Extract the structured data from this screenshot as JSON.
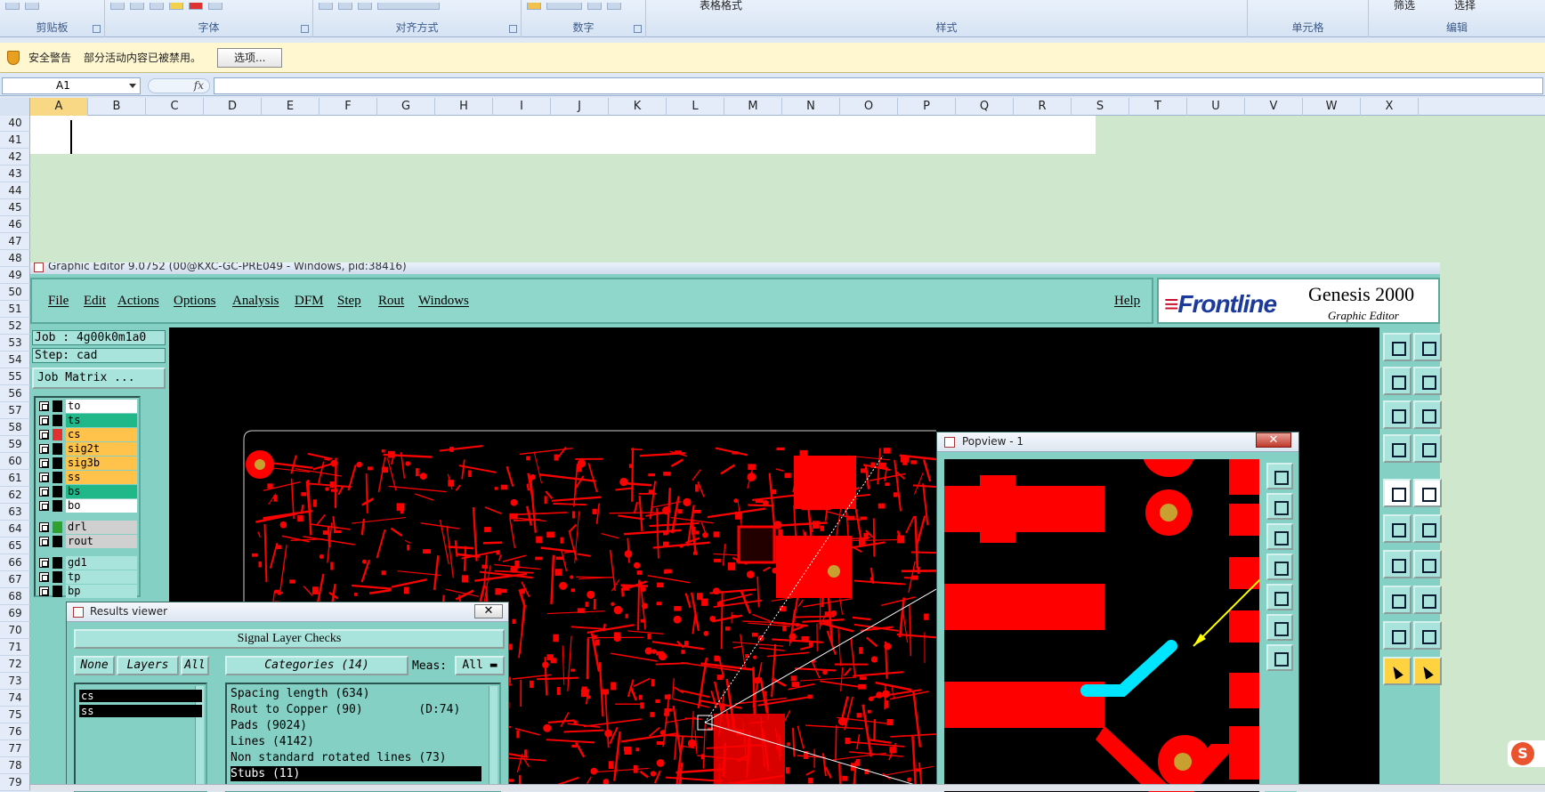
{
  "ribbon": {
    "groups": [
      {
        "label": "剪贴板"
      },
      {
        "label": "字体"
      },
      {
        "label": "对齐方式"
      },
      {
        "label": "数字"
      },
      {
        "label": "样式"
      },
      {
        "label": "单元格"
      },
      {
        "label": "编辑"
      }
    ],
    "styles_fragment": "表格格式",
    "filter_fragment": "筛选",
    "select_fragment": "选择"
  },
  "security": {
    "title": "安全警告",
    "message": "部分活动内容已被禁用。",
    "options_button": "选项..."
  },
  "formula_bar": {
    "name_box": "A1",
    "fx": "fx",
    "value": ""
  },
  "sheet": {
    "columns": [
      "A",
      "B",
      "C",
      "D",
      "E",
      "F",
      "G",
      "H",
      "I",
      "J",
      "K",
      "L",
      "M",
      "N",
      "O",
      "P",
      "Q",
      "R",
      "S",
      "T",
      "U",
      "V",
      "W",
      "X"
    ],
    "selected_column": "A",
    "rows": [
      "40",
      "41",
      "42",
      "43",
      "44",
      "45",
      "46",
      "47",
      "48",
      "49",
      "50",
      "51",
      "52",
      "53",
      "54",
      "55",
      "56",
      "57",
      "58",
      "59",
      "60",
      "61",
      "62",
      "63",
      "64",
      "65",
      "66",
      "67",
      "68",
      "69",
      "70",
      "71",
      "72",
      "73",
      "74",
      "75",
      "76",
      "77",
      "78",
      "79"
    ],
    "grid_color": "#cfe8cd"
  },
  "genesis": {
    "window_title": "Graphic Editor 9.0752 (00@KXC-GC-PRE049 - Windows, pid:38416)",
    "menu": [
      "File",
      "Edit",
      "Actions",
      "Options",
      "Analysis",
      "DFM",
      "Step",
      "Rout",
      "Windows"
    ],
    "help": "Help",
    "logo": {
      "brand": "Frontline",
      "product": "Genesis 2000",
      "subtitle": "Graphic Editor"
    },
    "job": "Job : 4g00k0m1a0",
    "step": "Step: cad",
    "job_matrix": "Job Matrix ...",
    "layers": [
      {
        "name": "to",
        "color": "#ffffff",
        "swatch": "#000000"
      },
      {
        "name": "ts",
        "color": "#20b888",
        "swatch": "#000000"
      },
      {
        "name": "cs",
        "color": "#ffc24a",
        "swatch": "#e03030"
      },
      {
        "name": "sig2t",
        "color": "#ffc24a",
        "swatch": "#000000"
      },
      {
        "name": "sig3b",
        "color": "#ffc24a",
        "swatch": "#000000"
      },
      {
        "name": "ss",
        "color": "#ffc24a",
        "swatch": "#000000"
      },
      {
        "name": "bs",
        "color": "#20b888",
        "swatch": "#000000"
      },
      {
        "name": "bo",
        "color": "#ffffff",
        "swatch": "#000000"
      },
      {
        "name": "drl",
        "color": "#d0d0d0",
        "swatch": "#30a030"
      },
      {
        "name": "rout",
        "color": "#d0d0d0",
        "swatch": "#000000"
      },
      {
        "name": "gd1",
        "color": "#a9e4dc",
        "swatch": "#000000"
      },
      {
        "name": "tp",
        "color": "#a9e4dc",
        "swatch": "#000000"
      },
      {
        "name": "bp",
        "color": "#a9e4dc",
        "swatch": "#000000"
      }
    ],
    "accent": "#84d0c4",
    "copper_color": "#ff0000",
    "highlight_color": "#00e5ff"
  },
  "results_viewer": {
    "title": "Results viewer",
    "header": "Signal Layer Checks",
    "none": "None",
    "layers_btn": "Layers",
    "all": "All",
    "categories_btn": "Categories (14)",
    "meas_label": "Meas:",
    "meas_value": "All",
    "layers": [
      "cs",
      "ss"
    ],
    "categories": [
      "Spacing length (634)",
      "Rout to Copper (90)        (D:74)",
      "Pads (9024)",
      "Lines (4142)",
      "Non standard rotated lines (73)",
      "Stubs (11)"
    ],
    "selected_category": "Stubs (11)"
  },
  "popview": {
    "title": "Popview - 1"
  }
}
